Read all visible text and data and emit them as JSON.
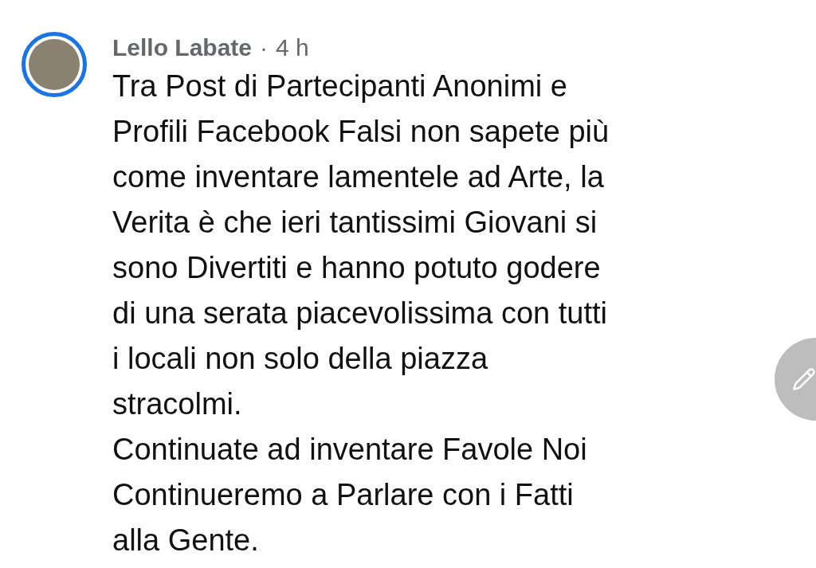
{
  "post": {
    "author": "Lello Labate",
    "separator": "·",
    "time": "4 h",
    "lines": [
      "Tra Post di Partecipanti Anonimi e",
      "Profili Facebook Falsi non sapete più",
      "come inventare lamentele ad Arte, la",
      "Verita è che ieri tantissimi Giovani si",
      "sono Divertiti e hanno potuto godere",
      "di una serata piacevolissima con tutti",
      "i locali non solo della piazza",
      "stracolmi.",
      "Continuate ad inventare Favole Noi",
      "Continueremo a Parlare con i Fatti",
      "alla Gente."
    ]
  }
}
